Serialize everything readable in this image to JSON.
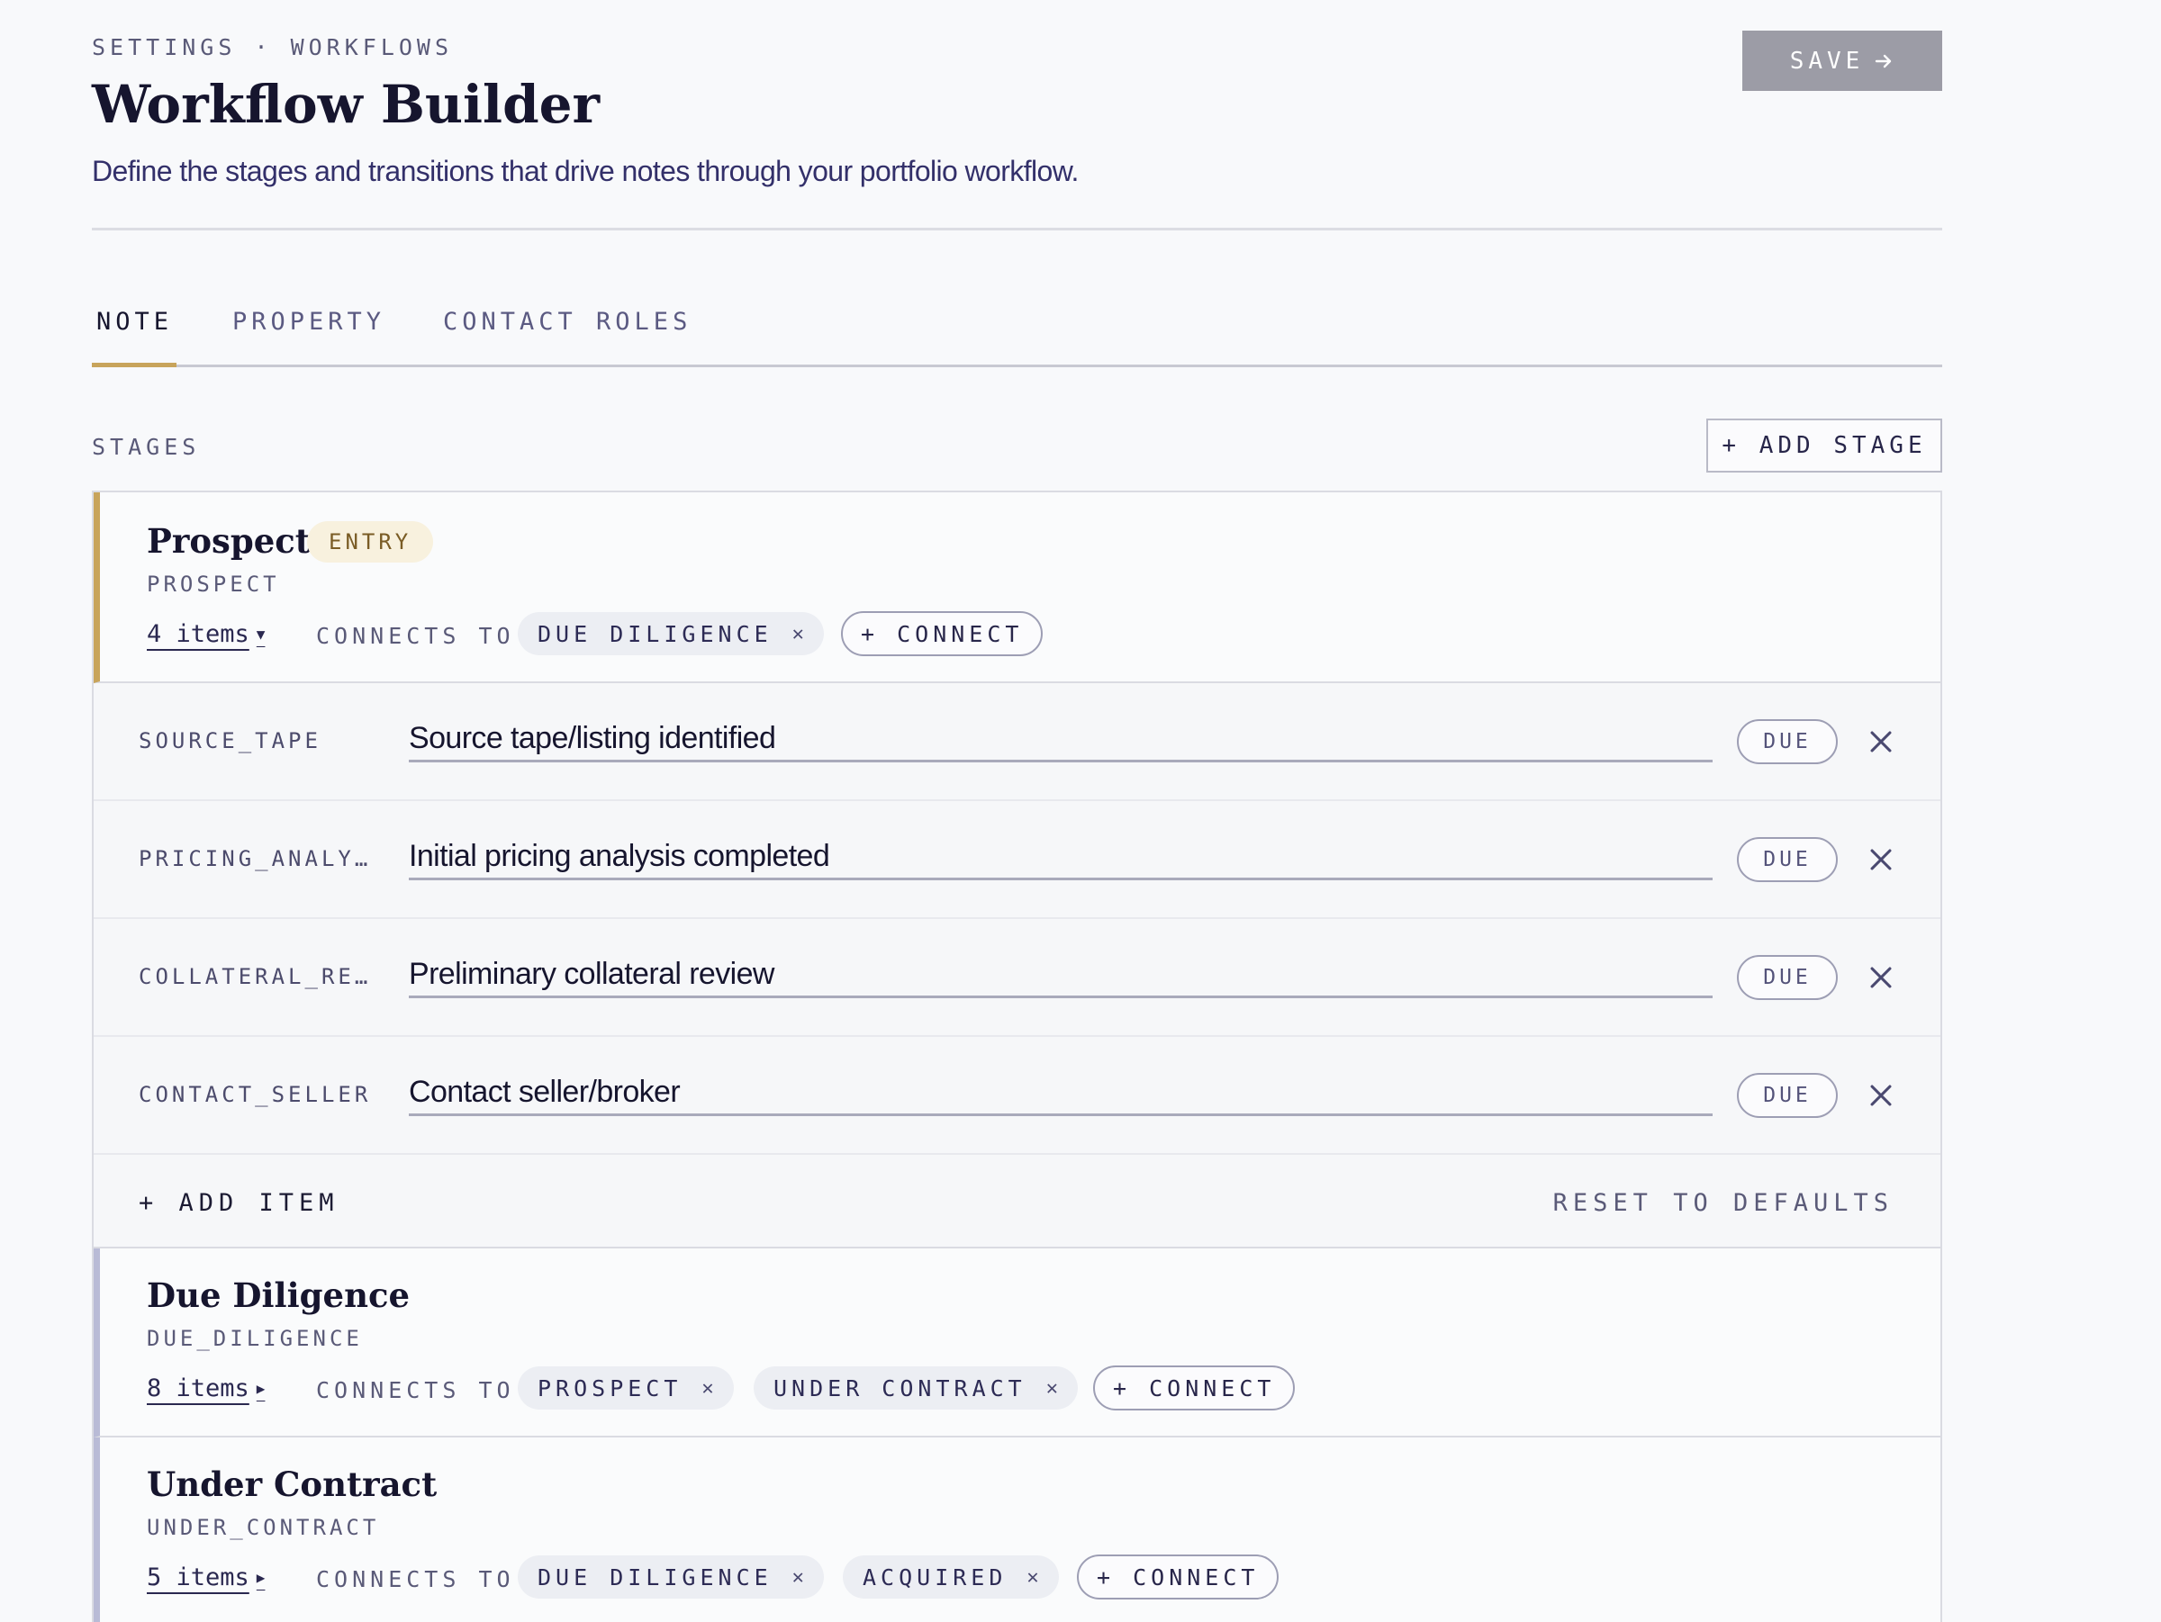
{
  "header": {
    "breadcrumb": "SETTINGS · WORKFLOWS",
    "title": "Workflow Builder",
    "subtitle": "Define the stages and transitions that drive notes through your portfolio workflow.",
    "save_label": "SAVE"
  },
  "tabs": [
    {
      "label": "NOTE",
      "active": true
    },
    {
      "label": "PROPERTY",
      "active": false
    },
    {
      "label": "CONTACT ROLES",
      "active": false
    }
  ],
  "stages_section": {
    "label": "STAGES",
    "add_stage_label": "+ ADD STAGE",
    "connects_label": "CONNECTS TO",
    "connect_label": "+ CONNECT",
    "due_label": "DUE",
    "add_item_label": "+ ADD ITEM",
    "reset_label": "RESET TO DEFAULTS",
    "entry_badge": "ENTRY"
  },
  "stages": [
    {
      "name": "Prospect",
      "key": "PROSPECT",
      "entry": true,
      "expanded": true,
      "items_count_label": "4 items",
      "connects": [
        "DUE DILIGENCE"
      ],
      "items": [
        {
          "key": "SOURCE_TAPE",
          "label": "Source tape/listing identified"
        },
        {
          "key": "PRICING_ANALY…",
          "label": "Initial pricing analysis completed"
        },
        {
          "key": "COLLATERAL_RE…",
          "label": "Preliminary collateral review"
        },
        {
          "key": "CONTACT_SELLER",
          "label": "Contact seller/broker"
        }
      ]
    },
    {
      "name": "Due Diligence",
      "key": "DUE_DILIGENCE",
      "entry": false,
      "expanded": false,
      "items_count_label": "8 items",
      "connects": [
        "PROSPECT",
        "UNDER CONTRACT"
      ]
    },
    {
      "name": "Under Contract",
      "key": "UNDER_CONTRACT",
      "entry": false,
      "expanded": false,
      "items_count_label": "5 items",
      "connects": [
        "DUE DILIGENCE",
        "ACQUIRED"
      ]
    }
  ],
  "colors": {
    "accent": "#c8a45b",
    "inactive_stage_bar": "#b9bbd6",
    "save_button": "#9c9ca6",
    "entry_badge_bg": "#f8f1de"
  },
  "icons": {
    "save_arrow": "arrow-right-icon",
    "chip_remove": "close-icon",
    "item_remove": "close-icon",
    "expanded_caret": "caret-down-icon",
    "collapsed_caret": "caret-right-icon"
  }
}
